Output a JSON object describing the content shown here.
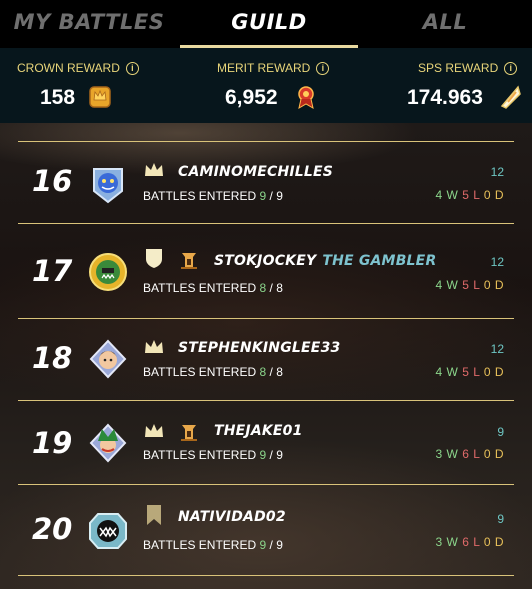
{
  "tabs": [
    {
      "label": "MY BATTLES",
      "active": false
    },
    {
      "label": "GUILD",
      "active": true
    },
    {
      "label": "ALL",
      "active": false
    }
  ],
  "rewards": [
    {
      "label": "CROWN REWARD",
      "value": "158",
      "icon": "crown-token-icon"
    },
    {
      "label": "MERIT REWARD",
      "value": "6,952",
      "icon": "merit-medal-icon"
    },
    {
      "label": "SPS REWARD",
      "value": "174.963",
      "icon": "sps-token-icon"
    }
  ],
  "battles_label": "BATTLES ENTERED",
  "players": [
    {
      "rank": "16",
      "name": "CAMINOMECHILLES",
      "title": "",
      "avatar": "blue-creature-avatar",
      "league_icon": "crown-icon",
      "extra_icon": "",
      "entered": "9",
      "total": "9",
      "score": "12",
      "wins": "4",
      "losses": "5",
      "draws": "0"
    },
    {
      "rank": "17",
      "name": "STOKJOCKEY",
      "title": "THE GAMBLER",
      "avatar": "orc-warrior-avatar",
      "league_icon": "shield-icon",
      "extra_icon": "tower-icon",
      "entered": "8",
      "total": "8",
      "score": "12",
      "wins": "4",
      "losses": "5",
      "draws": "0"
    },
    {
      "rank": "18",
      "name": "STEPHENKINGLEE33",
      "title": "",
      "avatar": "hero-avatar",
      "league_icon": "crown-icon",
      "extra_icon": "",
      "entered": "8",
      "total": "8",
      "score": "12",
      "wins": "4",
      "losses": "5",
      "draws": "0"
    },
    {
      "rank": "19",
      "name": "THEJAKE01",
      "title": "",
      "avatar": "jester-avatar",
      "league_icon": "crown-icon",
      "extra_icon": "tower-icon",
      "entered": "9",
      "total": "9",
      "score": "9",
      "wins": "3",
      "losses": "6",
      "draws": "0"
    },
    {
      "rank": "20",
      "name": "NATIVIDAD02",
      "title": "",
      "avatar": "monster-mouth-avatar",
      "league_icon": "banner-icon",
      "extra_icon": "",
      "entered": "9",
      "total": "9",
      "score": "9",
      "wins": "3",
      "losses": "6",
      "draws": "0"
    }
  ],
  "colors": {
    "accent": "#e8d9a0",
    "gold": "#e8d57a",
    "win": "#8bd58b",
    "loss": "#e06a6a",
    "draw": "#e8c15a",
    "score": "#6ec7c4",
    "title": "#7ec3cf"
  }
}
